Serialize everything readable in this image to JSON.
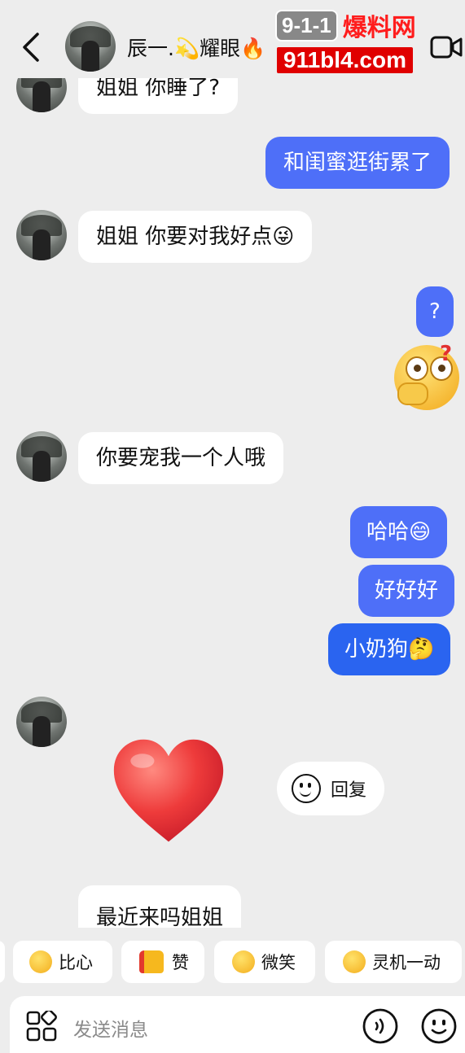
{
  "header": {
    "contact_name": "辰一.💫耀眼🔥",
    "watermark_top": "9-1-1",
    "watermark_cn": "爆料网",
    "watermark_url": "911bl4.com"
  },
  "messages": [
    {
      "from": "contact",
      "text": "姐姐 你睡了?"
    },
    {
      "from": "me",
      "text": "和闺蜜逛街累了"
    },
    {
      "from": "contact",
      "text": "姐姐 你要对我好点😜"
    },
    {
      "from": "me",
      "text": "?"
    },
    {
      "from": "me",
      "sticker": "surprised-face-emoji"
    },
    {
      "from": "contact",
      "text": "你要宠我一个人哦"
    },
    {
      "from": "me",
      "text": "哈哈😄"
    },
    {
      "from": "me",
      "text": "好好好"
    },
    {
      "from": "me",
      "text": "小奶狗🤔"
    },
    {
      "from": "contact",
      "sticker": "heart-emoji"
    },
    {
      "from": "contact",
      "text": "最近来吗姐姐"
    }
  ],
  "reply_action": {
    "label": "回复"
  },
  "quick_replies": [
    {
      "label": "比心",
      "icon": "blowing-kiss-emoji"
    },
    {
      "label": "赞",
      "icon": "thumbs-up-emoji"
    },
    {
      "label": "微笑",
      "icon": "smile-emoji"
    },
    {
      "label": "灵机一动",
      "icon": "thinking-emoji"
    }
  ],
  "input": {
    "placeholder": "发送消息"
  },
  "colors": {
    "background": "#ededed",
    "outgoing_bubble": "#4e6ff8",
    "incoming_bubble": "#ffffff"
  }
}
